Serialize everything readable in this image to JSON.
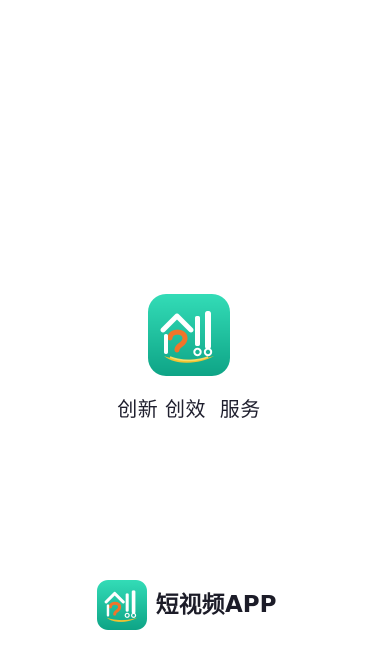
{
  "splash": {
    "slogan": "创新 创效  服务",
    "brand_name": "短视频APP",
    "logo_icon": "chuang-character-app-icon",
    "colors": {
      "background": "#ffffff",
      "icon_gradient_top": "#2fd8b4",
      "icon_gradient_bottom": "#0fa889",
      "icon_accent_orange": "#f0742a",
      "icon_accent_yellow": "#f2c230",
      "text_primary": "#1f1f2e"
    }
  }
}
